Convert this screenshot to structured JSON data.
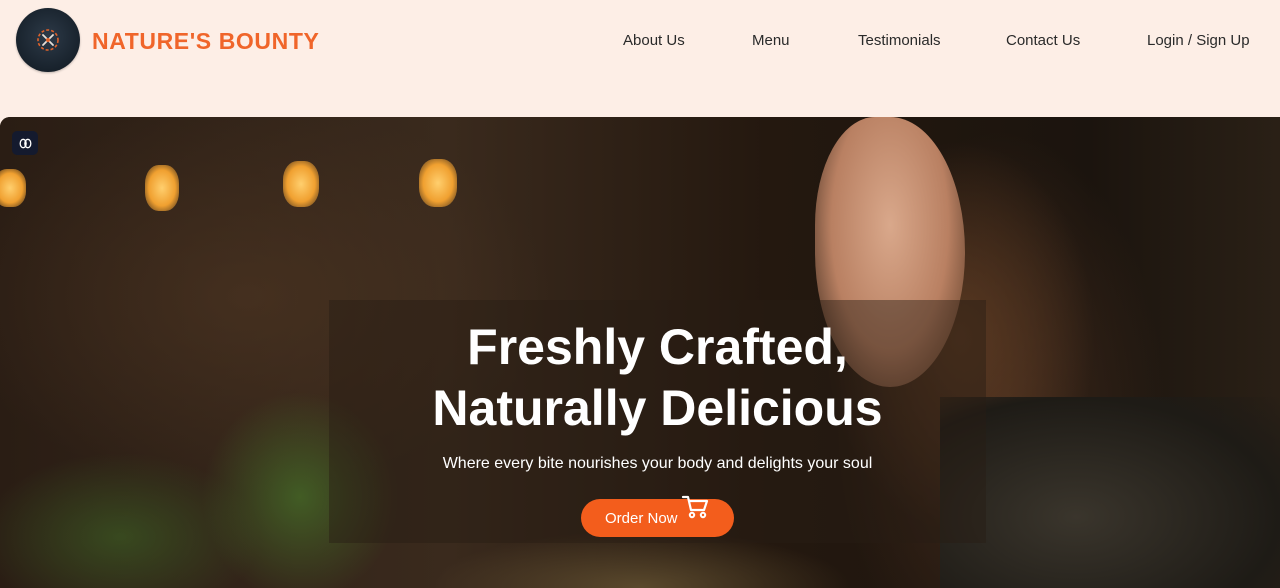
{
  "brand": {
    "name": "NATURE'S BOUNTY",
    "logo_icon": "crossed-utensils-wreath-icon",
    "accent_color": "#f0652a"
  },
  "nav": {
    "items": [
      {
        "label": "About Us"
      },
      {
        "label": "Menu"
      },
      {
        "label": "Testimonials"
      },
      {
        "label": "Contact Us"
      },
      {
        "label": "Login / Sign Up"
      }
    ]
  },
  "hero": {
    "title_line1": "Freshly Crafted,",
    "title_line2": "Naturally Delicious",
    "subtitle": "Where every bite nourishes your body and delights your soul",
    "cta_label": "Order Now",
    "cta_icon": "shopping-cart-icon",
    "cta_color": "#f35d1c",
    "badge_icon": "brain-icon"
  }
}
